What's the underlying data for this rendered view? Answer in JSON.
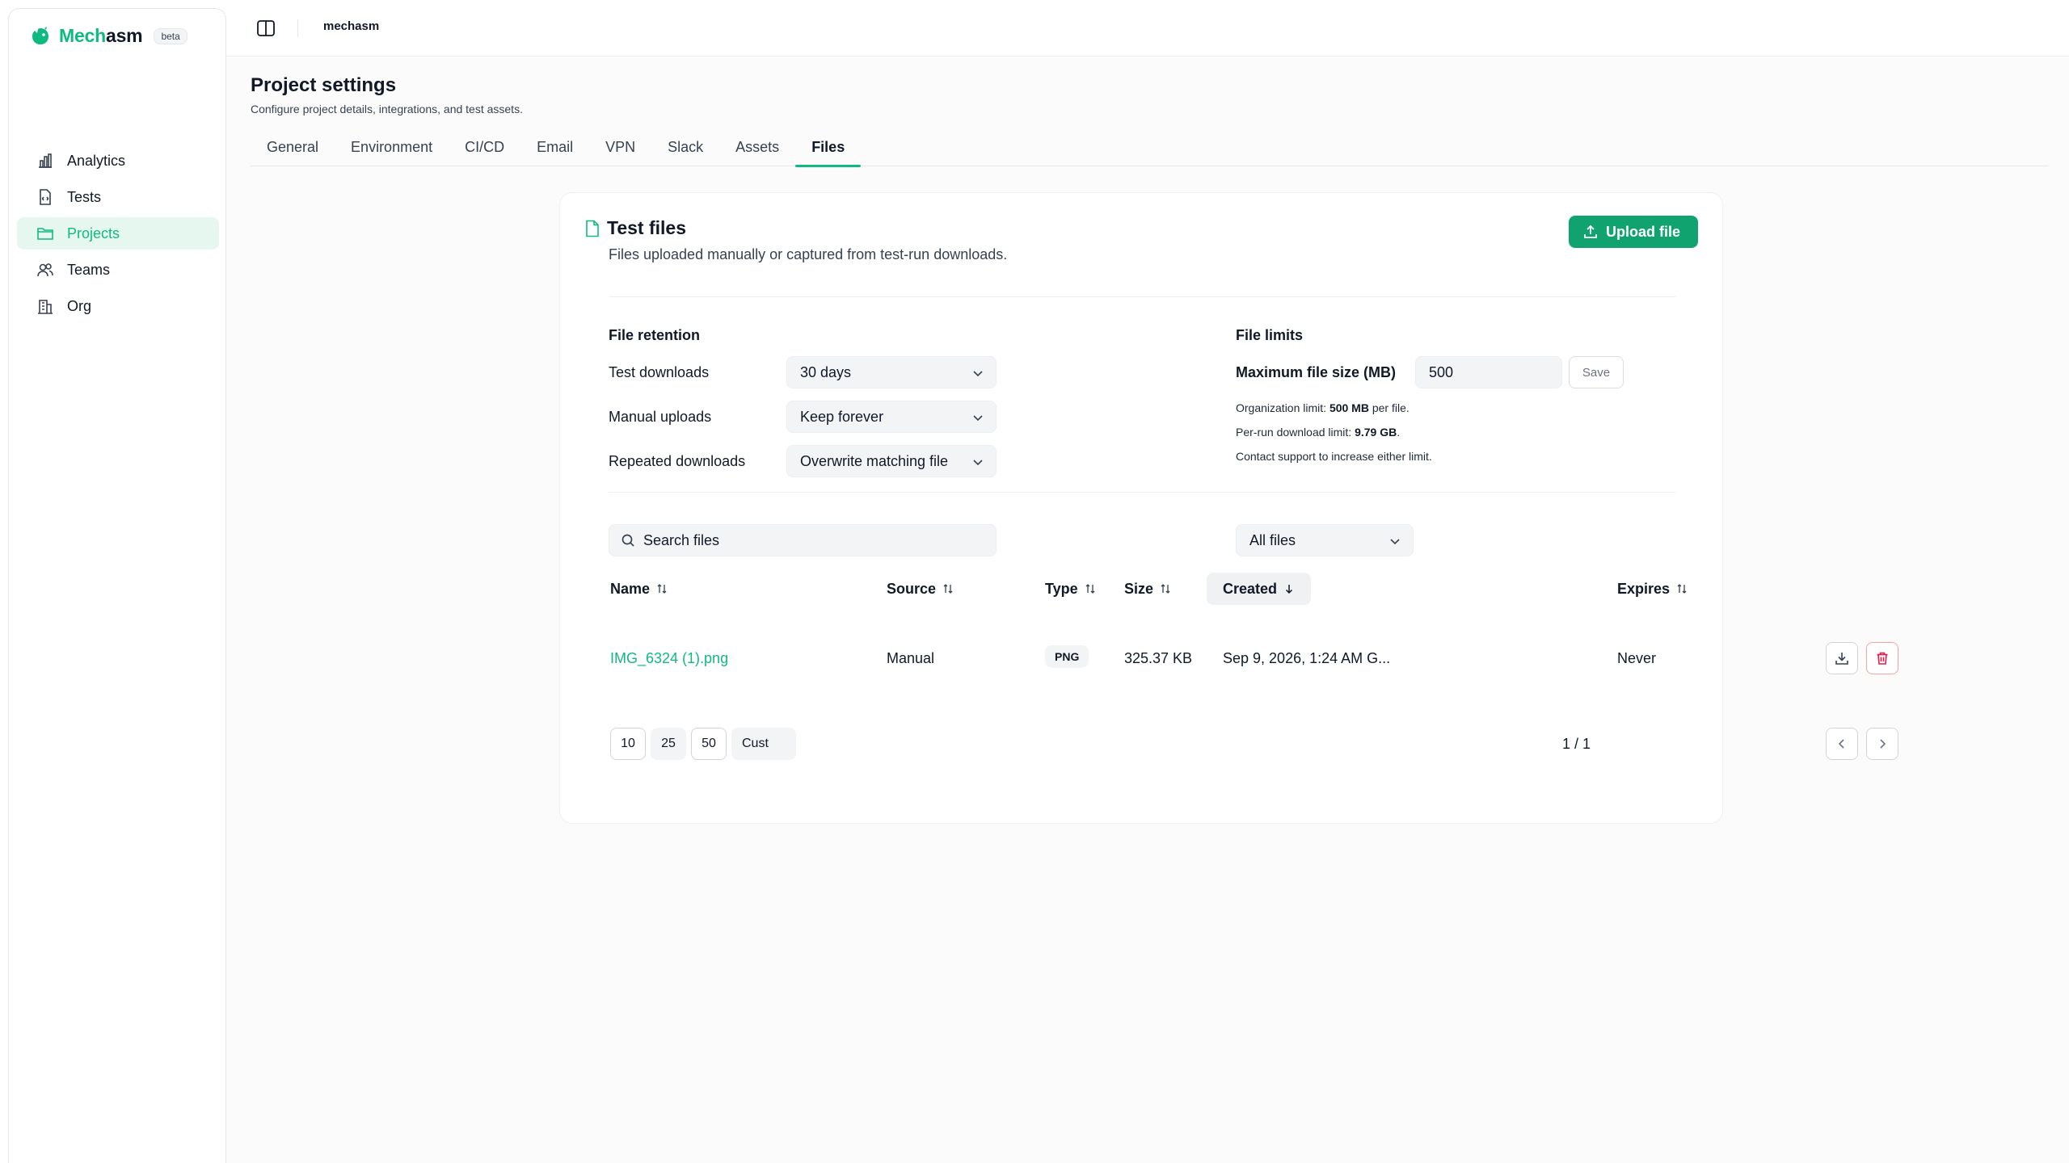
{
  "brand": {
    "name_accent": "Mech",
    "name_rest": "asm",
    "badge": "beta"
  },
  "sidebar": {
    "items": [
      {
        "label": "Analytics",
        "icon": "bar-chart-icon"
      },
      {
        "label": "Tests",
        "icon": "test-file-icon"
      },
      {
        "label": "Projects",
        "icon": "folder-icon",
        "active": true
      },
      {
        "label": "Teams",
        "icon": "users-icon"
      },
      {
        "label": "Org",
        "icon": "building-icon"
      }
    ]
  },
  "topbar": {
    "breadcrumb": "mechasm"
  },
  "page": {
    "title": "Project settings",
    "subtitle": "Configure project details, integrations, and test assets."
  },
  "tabs": [
    {
      "label": "General"
    },
    {
      "label": "Environment"
    },
    {
      "label": "CI/CD"
    },
    {
      "label": "Email"
    },
    {
      "label": "VPN"
    },
    {
      "label": "Slack"
    },
    {
      "label": "Assets"
    },
    {
      "label": "Files",
      "active": true
    }
  ],
  "card": {
    "title": "Test files",
    "subtitle": "Files uploaded manually or captured from test-run downloads.",
    "upload_label": "Upload file"
  },
  "retention": {
    "heading": "File retention",
    "rows": [
      {
        "label": "Test downloads",
        "value": "30 days"
      },
      {
        "label": "Manual uploads",
        "value": "Keep forever"
      },
      {
        "label": "Repeated downloads",
        "value": "Overwrite matching file"
      }
    ]
  },
  "limits": {
    "heading": "File limits",
    "max_label": "Maximum file size (MB)",
    "max_value": "500",
    "save_label": "Save",
    "org_prefix": "Organization limit:",
    "org_value": "500 MB",
    "org_suffix": "per file.",
    "run_prefix": "Per-run download limit:",
    "run_value": "9.79 GB",
    "run_suffix": ".",
    "support_note": "Contact support to increase either limit."
  },
  "filters": {
    "search_placeholder": "Search files",
    "type_value": "All files"
  },
  "table": {
    "headers": {
      "name": "Name",
      "source": "Source",
      "type": "Type",
      "size": "Size",
      "created": "Created",
      "expires": "Expires"
    },
    "rows": [
      {
        "name": "IMG_6324 (1).png",
        "source": "Manual",
        "type": "PNG",
        "size": "325.37 KB",
        "created": "Sep 9, 2026, 1:24 AM G...",
        "expires": "Never"
      }
    ]
  },
  "pagination": {
    "sizes": [
      "10",
      "25",
      "50",
      "Cust"
    ],
    "page_info": "1 / 1"
  },
  "colors": {
    "accent": "#10b981",
    "upload_button": "#10a36f",
    "danger": "#e11d48"
  }
}
